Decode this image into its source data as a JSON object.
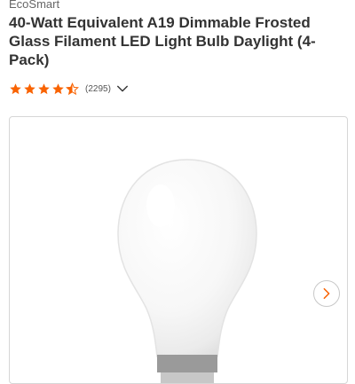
{
  "product": {
    "brand": "EcoSmart",
    "title": "40-Watt Equivalent A19 Dimmable Frosted Glass Filament LED Light Bulb Daylight (4-Pack)"
  },
  "rating": {
    "stars": 4.5,
    "max_stars": 5,
    "review_count": "(2295)",
    "expand_icon": "chevron-down-icon"
  },
  "gallery": {
    "image": "frosted-a19-bulb",
    "next_icon": "chevron-right-icon"
  },
  "colors": {
    "star": "#f96302",
    "accent": "#f96302",
    "title": "#333333"
  }
}
